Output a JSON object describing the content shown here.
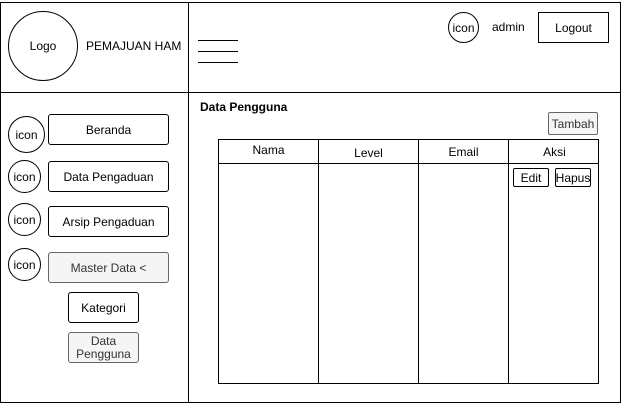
{
  "header": {
    "logo": "Logo",
    "app_title": "PEMAJUAN HAM",
    "user_icon": "icon",
    "username": "admin",
    "logout_label": "Logout"
  },
  "sidebar": {
    "items": [
      {
        "icon": "icon",
        "label": "Beranda"
      },
      {
        "icon": "icon",
        "label": "Data Pengaduan"
      },
      {
        "icon": "icon",
        "label": "Arsip Pengaduan"
      },
      {
        "icon": "icon",
        "label": "Master Data <"
      }
    ],
    "submenu": [
      {
        "label": "Kategori"
      },
      {
        "label": "Data Pengguna"
      }
    ]
  },
  "main": {
    "title": "Data Pengguna",
    "add_label": "Tambah",
    "table": {
      "columns": [
        "Nama",
        "Level",
        "Email",
        "Aksi"
      ],
      "row_actions": {
        "edit": "Edit",
        "delete": "Hapus"
      }
    }
  }
}
